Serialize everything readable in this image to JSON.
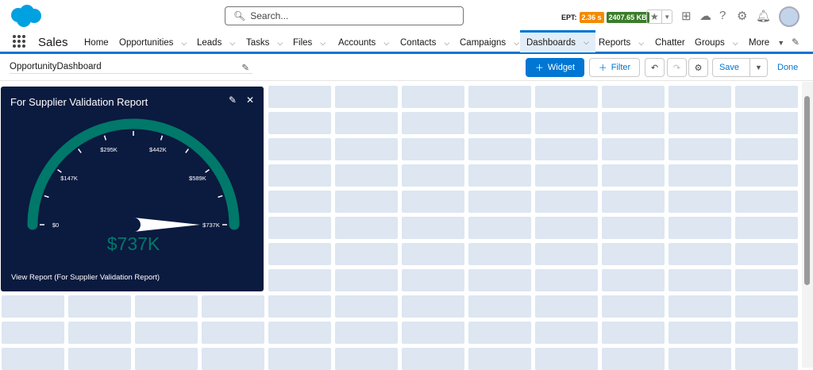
{
  "header": {
    "search_placeholder": "Search...",
    "ept_label": "EPT:",
    "ept_value": "2.36 s",
    "memory_value": "2407.65 KB",
    "colors": {
      "ept": "#f38b00",
      "memory": "#3b7d2b",
      "brand": "#0176d3"
    }
  },
  "nav": {
    "app_name": "Sales",
    "items": [
      {
        "label": "Home",
        "chevron": false
      },
      {
        "label": "Opportunities",
        "chevron": true
      },
      {
        "label": "Leads",
        "chevron": true
      },
      {
        "label": "Tasks",
        "chevron": true
      },
      {
        "label": "Files",
        "chevron": true
      },
      {
        "label": "Accounts",
        "chevron": true
      },
      {
        "label": "Contacts",
        "chevron": true
      },
      {
        "label": "Campaigns",
        "chevron": true
      },
      {
        "label": "Dashboards",
        "chevron": true,
        "active": true
      },
      {
        "label": "Reports",
        "chevron": true
      },
      {
        "label": "Chatter",
        "chevron": false
      },
      {
        "label": "Groups",
        "chevron": true
      },
      {
        "label": "More",
        "chevron": true
      }
    ]
  },
  "toolbar": {
    "dashboard_name": "OpportunityDashboard",
    "widget_label": "Widget",
    "filter_label": "Filter",
    "save_label": "Save",
    "done_label": "Done"
  },
  "widget": {
    "title": "For Supplier Validation Report",
    "value": "$737K",
    "link": "View Report (For Supplier Validation Report)",
    "gauge": {
      "min": 0,
      "max": 737,
      "current": 737,
      "tick_labels": [
        "$0",
        "$147K",
        "$295K",
        "$442K",
        "$589K",
        "$737K"
      ],
      "color": "#00786a"
    }
  }
}
